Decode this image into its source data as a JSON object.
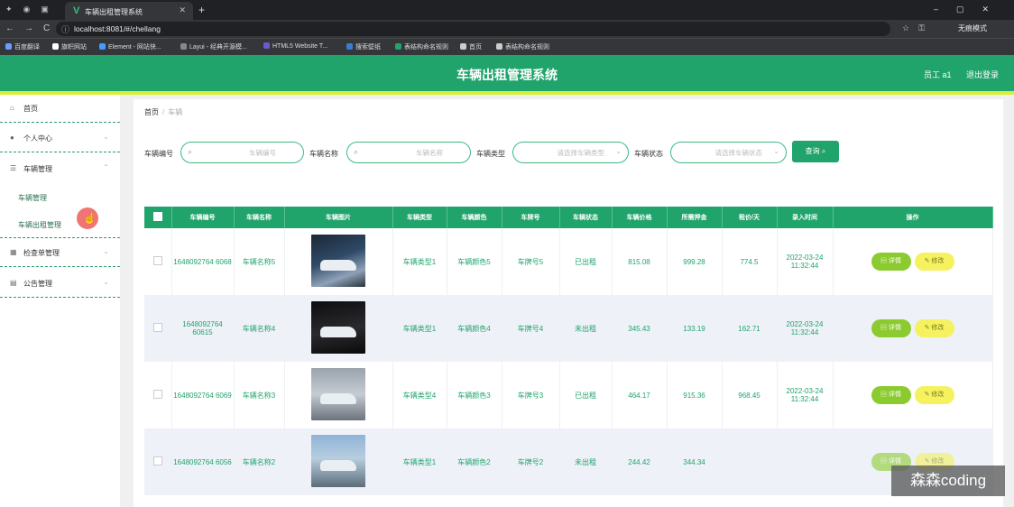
{
  "browser": {
    "tab_title": "车辆出租管理系统",
    "url": "localhost:8081/#/chellang",
    "profile": "无痕模式",
    "bookmarks": [
      "百度翻译",
      "旗帜网站",
      "Element - 网站快...",
      "Layui - 经典开源模...",
      "HTML5 Website T...",
      "搜索壁纸",
      "表结构命名规则",
      "首页",
      "表结构命名规则"
    ]
  },
  "header": {
    "title": "车辆出租管理系统",
    "user": "员工 a1",
    "logout": "退出登录"
  },
  "sidebar": {
    "items": [
      {
        "label": "首页",
        "icon": "home-icon"
      },
      {
        "label": "个人中心",
        "icon": "user-icon"
      },
      {
        "label": "车辆管理",
        "icon": "menu-icon"
      },
      {
        "label": "检查单管理",
        "icon": "grid-icon"
      },
      {
        "label": "公告管理",
        "icon": "ticket-icon"
      }
    ],
    "subitems": [
      "车辆管理",
      "车辆出租管理"
    ]
  },
  "breadcrumb": {
    "home": "首页",
    "current": "车辆"
  },
  "filters": {
    "vehicle_no_label": "车辆编号",
    "vehicle_no_placeholder": "车辆编号",
    "vehicle_name_label": "车辆名称",
    "vehicle_name_placeholder": "车辆名称",
    "vehicle_type_label": "车辆类型",
    "vehicle_type_placeholder": "请选择车辆类型",
    "vehicle_status_label": "车辆状态",
    "vehicle_status_placeholder": "请选择车辆状态",
    "search_label": "查询"
  },
  "table": {
    "headers": [
      "车辆编号",
      "车辆名称",
      "车辆图片",
      "车辆类型",
      "车辆颜色",
      "车牌号",
      "车辆状态",
      "车辆价格",
      "所需押金",
      "租价/天",
      "录入时间",
      "操作"
    ],
    "rows": [
      {
        "no": "1648092764 6068",
        "name": "车辆名称5",
        "type": "车辆类型1",
        "color": "车辆颜色5",
        "plate": "车牌号5",
        "status": "已出租",
        "price": "815.08",
        "deposit": "999.28",
        "rent": "774.5",
        "time": "2022-03-24 11:32:44"
      },
      {
        "no": "1648092764 60615",
        "name": "车辆名称4",
        "type": "车辆类型1",
        "color": "车辆颜色4",
        "plate": "车牌号4",
        "status": "未出租",
        "price": "345.43",
        "deposit": "133.19",
        "rent": "162.71",
        "time": "2022-03-24 11:32:44"
      },
      {
        "no": "1648092764 6069",
        "name": "车辆名称3",
        "type": "车辆类型4",
        "color": "车辆颜色3",
        "plate": "车牌号3",
        "status": "已出租",
        "price": "464.17",
        "deposit": "915.36",
        "rent": "968.45",
        "time": "2022-03-24 11:32:44"
      },
      {
        "no": "1648092764 6056",
        "name": "车辆名称2",
        "type": "车辆类型1",
        "color": "车辆颜色2",
        "plate": "车牌号2",
        "status": "未出租",
        "price": "244.42",
        "deposit": "344.34",
        "rent": "",
        "time": ""
      }
    ],
    "detail_label": "详情",
    "edit_label": "修改"
  },
  "watermark": "森森coding"
}
